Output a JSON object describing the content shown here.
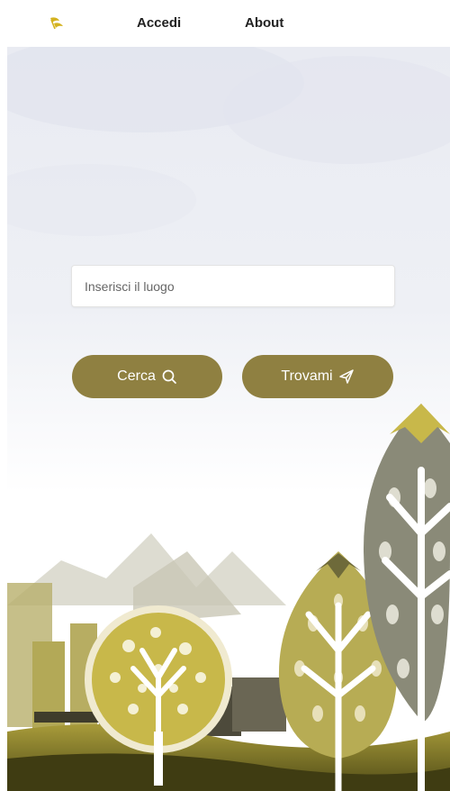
{
  "nav": {
    "logo_icon": "leaf-logo-icon",
    "accedi_label": "Accedi",
    "about_label": "About"
  },
  "search": {
    "placeholder": "Inserisci il luogo",
    "value": ""
  },
  "actions": {
    "cerca_label": "Cerca",
    "cerca_icon": "search-icon",
    "trovami_label": "Trovami",
    "trovami_icon": "paper-plane-icon"
  },
  "colors": {
    "accent": "#8f8041",
    "tree_gold": "#c8b84a",
    "tree_gray": "#8a8a78",
    "ground": "#5d5a1e"
  }
}
